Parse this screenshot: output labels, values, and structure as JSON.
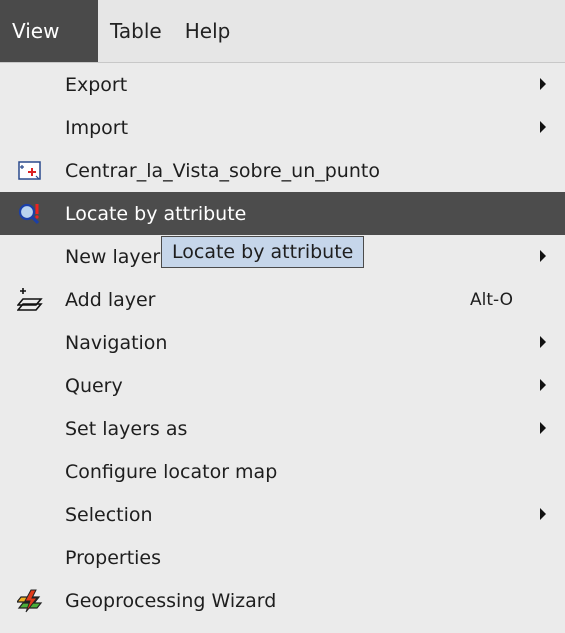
{
  "menubar": {
    "items": [
      {
        "label": "View"
      },
      {
        "label": "Table"
      },
      {
        "label": "Help"
      }
    ]
  },
  "menu": {
    "items": [
      {
        "label": "Export",
        "submenu": true
      },
      {
        "label": "Import",
        "submenu": true
      },
      {
        "label": "Centrar_la_Vista_sobre_un_punto",
        "icon": "center-view-icon"
      },
      {
        "label": "Locate by attribute",
        "icon": "locate-by-attribute-icon",
        "highlighted": true
      },
      {
        "label": "New layer",
        "submenu": true
      },
      {
        "label": "Add layer",
        "icon": "add-layer-icon",
        "shortcut": "Alt-O"
      },
      {
        "label": "Navigation",
        "submenu": true
      },
      {
        "label": "Query",
        "submenu": true
      },
      {
        "label": "Set layers as",
        "submenu": true
      },
      {
        "label": "Configure locator map"
      },
      {
        "label": "Selection",
        "submenu": true
      },
      {
        "label": "Properties"
      },
      {
        "label": "Geoprocessing Wizard",
        "icon": "geoprocessing-wizard-icon"
      }
    ]
  },
  "tooltip": {
    "text": "Locate by attribute"
  },
  "colors": {
    "highlight": "#4c4c4c",
    "tooltip_bg": "#c6d6ea",
    "menu_bg": "#ebebeb"
  }
}
